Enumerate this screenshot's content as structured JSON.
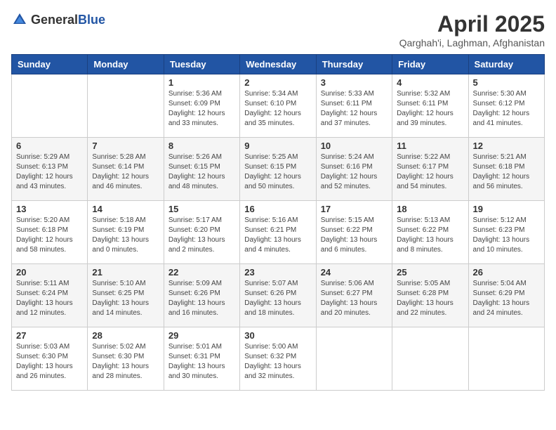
{
  "header": {
    "logo": {
      "general": "General",
      "blue": "Blue"
    },
    "title": "April 2025",
    "subtitle": "Qarghah'i, Laghman, Afghanistan"
  },
  "weekdays": [
    "Sunday",
    "Monday",
    "Tuesday",
    "Wednesday",
    "Thursday",
    "Friday",
    "Saturday"
  ],
  "weeks": [
    [
      {
        "day": null
      },
      {
        "day": null
      },
      {
        "day": 1,
        "sunrise": "5:36 AM",
        "sunset": "6:09 PM",
        "daylight": "12 hours and 33 minutes."
      },
      {
        "day": 2,
        "sunrise": "5:34 AM",
        "sunset": "6:10 PM",
        "daylight": "12 hours and 35 minutes."
      },
      {
        "day": 3,
        "sunrise": "5:33 AM",
        "sunset": "6:11 PM",
        "daylight": "12 hours and 37 minutes."
      },
      {
        "day": 4,
        "sunrise": "5:32 AM",
        "sunset": "6:11 PM",
        "daylight": "12 hours and 39 minutes."
      },
      {
        "day": 5,
        "sunrise": "5:30 AM",
        "sunset": "6:12 PM",
        "daylight": "12 hours and 41 minutes."
      }
    ],
    [
      {
        "day": 6,
        "sunrise": "5:29 AM",
        "sunset": "6:13 PM",
        "daylight": "12 hours and 43 minutes."
      },
      {
        "day": 7,
        "sunrise": "5:28 AM",
        "sunset": "6:14 PM",
        "daylight": "12 hours and 46 minutes."
      },
      {
        "day": 8,
        "sunrise": "5:26 AM",
        "sunset": "6:15 PM",
        "daylight": "12 hours and 48 minutes."
      },
      {
        "day": 9,
        "sunrise": "5:25 AM",
        "sunset": "6:15 PM",
        "daylight": "12 hours and 50 minutes."
      },
      {
        "day": 10,
        "sunrise": "5:24 AM",
        "sunset": "6:16 PM",
        "daylight": "12 hours and 52 minutes."
      },
      {
        "day": 11,
        "sunrise": "5:22 AM",
        "sunset": "6:17 PM",
        "daylight": "12 hours and 54 minutes."
      },
      {
        "day": 12,
        "sunrise": "5:21 AM",
        "sunset": "6:18 PM",
        "daylight": "12 hours and 56 minutes."
      }
    ],
    [
      {
        "day": 13,
        "sunrise": "5:20 AM",
        "sunset": "6:18 PM",
        "daylight": "12 hours and 58 minutes."
      },
      {
        "day": 14,
        "sunrise": "5:18 AM",
        "sunset": "6:19 PM",
        "daylight": "13 hours and 0 minutes."
      },
      {
        "day": 15,
        "sunrise": "5:17 AM",
        "sunset": "6:20 PM",
        "daylight": "13 hours and 2 minutes."
      },
      {
        "day": 16,
        "sunrise": "5:16 AM",
        "sunset": "6:21 PM",
        "daylight": "13 hours and 4 minutes."
      },
      {
        "day": 17,
        "sunrise": "5:15 AM",
        "sunset": "6:22 PM",
        "daylight": "13 hours and 6 minutes."
      },
      {
        "day": 18,
        "sunrise": "5:13 AM",
        "sunset": "6:22 PM",
        "daylight": "13 hours and 8 minutes."
      },
      {
        "day": 19,
        "sunrise": "5:12 AM",
        "sunset": "6:23 PM",
        "daylight": "13 hours and 10 minutes."
      }
    ],
    [
      {
        "day": 20,
        "sunrise": "5:11 AM",
        "sunset": "6:24 PM",
        "daylight": "13 hours and 12 minutes."
      },
      {
        "day": 21,
        "sunrise": "5:10 AM",
        "sunset": "6:25 PM",
        "daylight": "13 hours and 14 minutes."
      },
      {
        "day": 22,
        "sunrise": "5:09 AM",
        "sunset": "6:26 PM",
        "daylight": "13 hours and 16 minutes."
      },
      {
        "day": 23,
        "sunrise": "5:07 AM",
        "sunset": "6:26 PM",
        "daylight": "13 hours and 18 minutes."
      },
      {
        "day": 24,
        "sunrise": "5:06 AM",
        "sunset": "6:27 PM",
        "daylight": "13 hours and 20 minutes."
      },
      {
        "day": 25,
        "sunrise": "5:05 AM",
        "sunset": "6:28 PM",
        "daylight": "13 hours and 22 minutes."
      },
      {
        "day": 26,
        "sunrise": "5:04 AM",
        "sunset": "6:29 PM",
        "daylight": "13 hours and 24 minutes."
      }
    ],
    [
      {
        "day": 27,
        "sunrise": "5:03 AM",
        "sunset": "6:30 PM",
        "daylight": "13 hours and 26 minutes."
      },
      {
        "day": 28,
        "sunrise": "5:02 AM",
        "sunset": "6:30 PM",
        "daylight": "13 hours and 28 minutes."
      },
      {
        "day": 29,
        "sunrise": "5:01 AM",
        "sunset": "6:31 PM",
        "daylight": "13 hours and 30 minutes."
      },
      {
        "day": 30,
        "sunrise": "5:00 AM",
        "sunset": "6:32 PM",
        "daylight": "13 hours and 32 minutes."
      },
      {
        "day": null
      },
      {
        "day": null
      },
      {
        "day": null
      }
    ]
  ]
}
